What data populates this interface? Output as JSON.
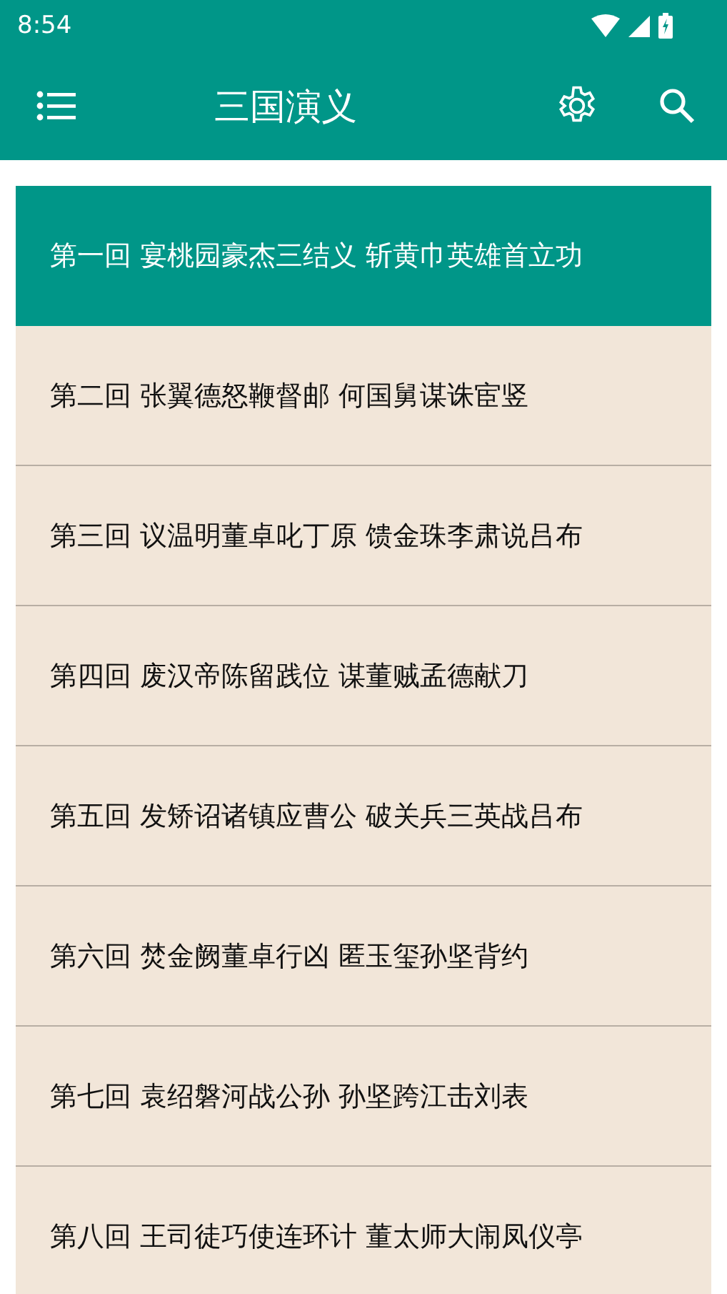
{
  "status_bar": {
    "time": "8:54"
  },
  "app_bar": {
    "title": "三国演义"
  },
  "chapters": [
    {
      "title": "第一回 宴桃园豪杰三结义 斩黄巾英雄首立功",
      "selected": true
    },
    {
      "title": "第二回 张翼德怒鞭督邮 何国舅谋诛宦竖",
      "selected": false
    },
    {
      "title": "第三回 议温明董卓叱丁原 馈金珠李肃说吕布",
      "selected": false
    },
    {
      "title": "第四回 废汉帝陈留践位 谋董贼孟德献刀",
      "selected": false
    },
    {
      "title": "第五回 发矫诏诸镇应曹公 破关兵三英战吕布",
      "selected": false
    },
    {
      "title": "第六回 焚金阙董卓行凶 匿玉玺孙坚背约",
      "selected": false
    },
    {
      "title": "第七回 袁绍磐河战公孙 孙坚跨江击刘表",
      "selected": false
    },
    {
      "title": "第八回 王司徒巧使连环计 董太师大闹凤仪亭",
      "selected": false
    }
  ]
}
